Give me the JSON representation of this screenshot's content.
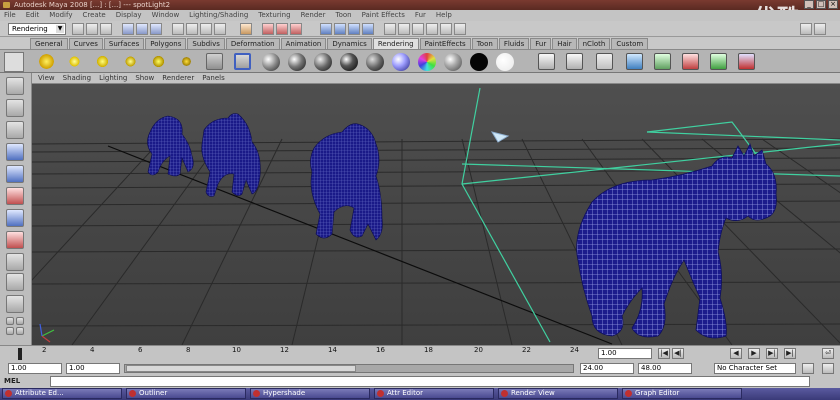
{
  "window": {
    "title": "Autodesk Maya 2008 [...] : [...] --- spotLight2",
    "watermark": "优酷",
    "controls": [
      "_",
      "□",
      "×"
    ]
  },
  "menubar": {
    "items": [
      "File",
      "Edit",
      "Modify",
      "Create",
      "Display",
      "Window",
      "Lighting/Shading",
      "Texturing",
      "Render",
      "Toon",
      "Paint Effects",
      "Fur",
      "Help"
    ]
  },
  "statusline": {
    "mode": "Rendering"
  },
  "shelf": {
    "tabs": [
      "General",
      "Curves",
      "Surfaces",
      "Polygons",
      "Subdivs",
      "Deformation",
      "Animation",
      "Dynamics",
      "Rendering",
      "PaintEffects",
      "Toon",
      "Fluids",
      "Fur",
      "Hair",
      "nCloth",
      "Custom"
    ],
    "active_tab": "Rendering"
  },
  "panel_menu": {
    "items": [
      "View",
      "Shading",
      "Lighting",
      "Show",
      "Renderer",
      "Panels"
    ]
  },
  "timeslider": {
    "ticks": [
      "2",
      "4",
      "6",
      "8",
      "10",
      "12",
      "14",
      "16",
      "18",
      "20",
      "22",
      "24"
    ],
    "current_frame": "1.00",
    "buttons": [
      "|◀",
      "◀|",
      "◀",
      "▶",
      "▶|",
      "▶|",
      "⏎"
    ]
  },
  "range": {
    "start": "1.00",
    "playback_start": "1.00",
    "playback_end": "24.00",
    "end": "48.00",
    "character_set": "No Character Set"
  },
  "command": {
    "label": "MEL"
  },
  "taskbar": {
    "items": [
      "Attribute Ed...",
      "Outliner",
      "Hypershade",
      "Attr Editor",
      "Render View",
      "Graph Editor"
    ]
  },
  "colors": {
    "mesh": "#1c1c8c",
    "wire": "#9aa0e8",
    "light_frustum": "#40d0a0",
    "grid": "#2c2c2c"
  }
}
